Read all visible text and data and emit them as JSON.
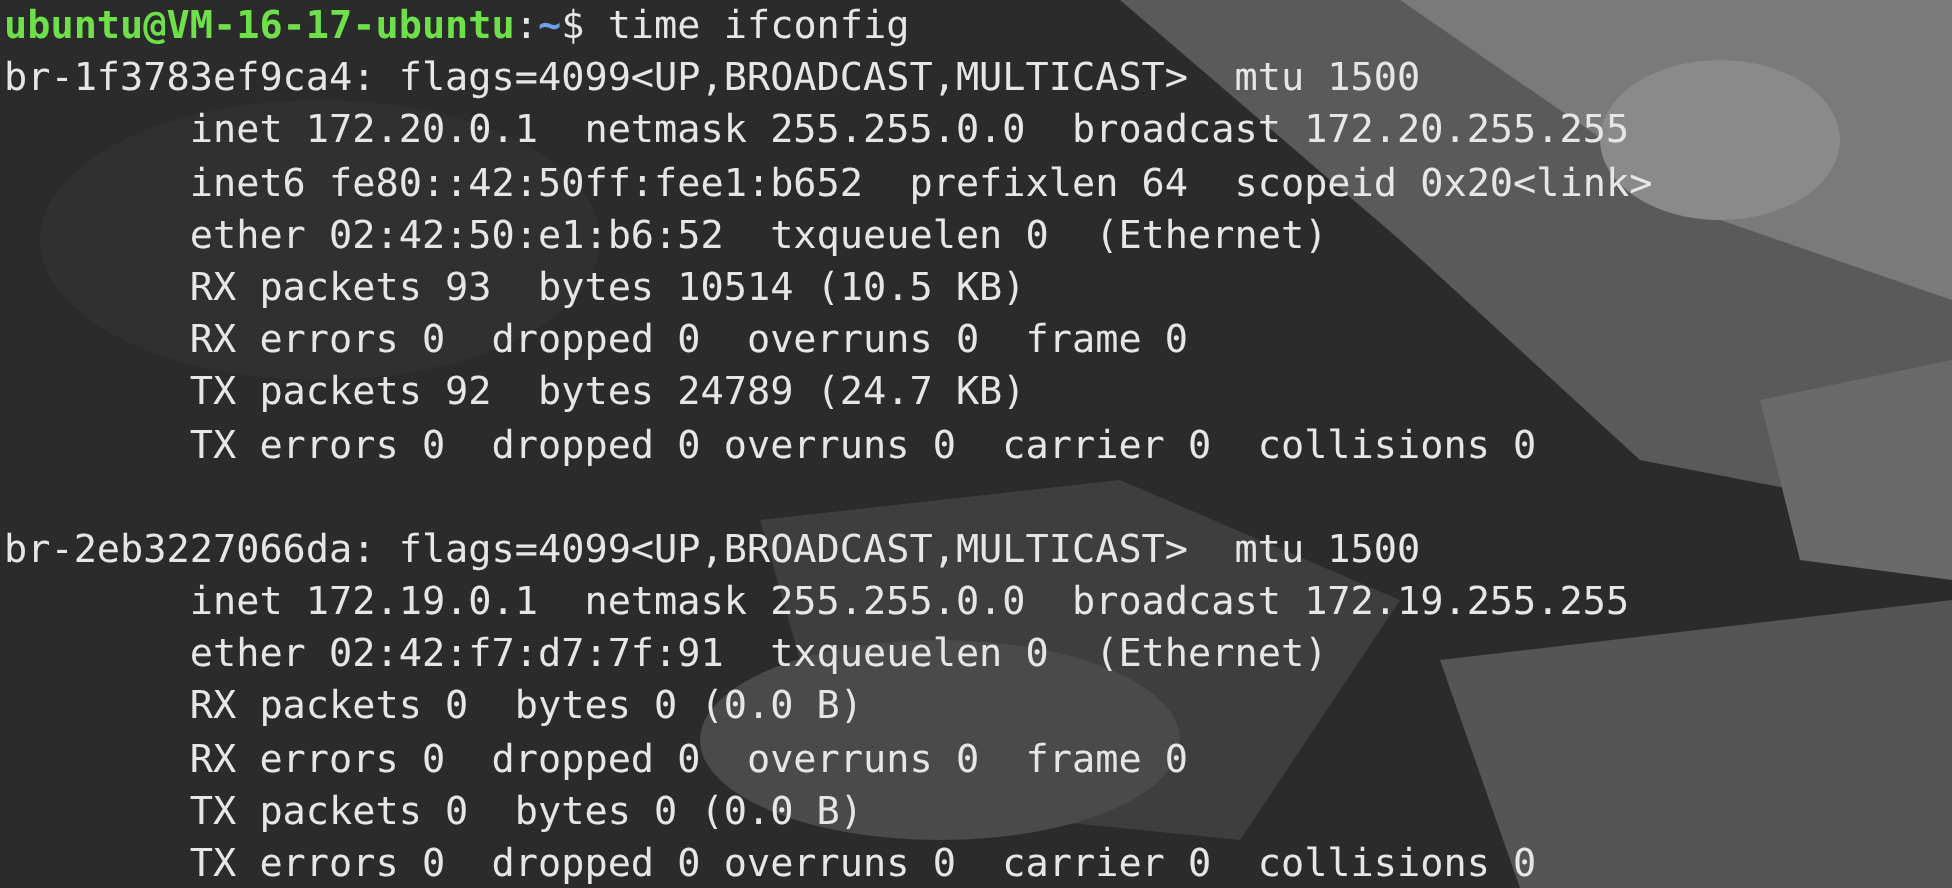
{
  "prompt": {
    "user_host": "ubuntu@VM-16-17-ubuntu",
    "separator": ":",
    "path": "~",
    "symbol": "$",
    "command": "time ifconfig"
  },
  "interfaces": [
    {
      "lines": [
        "br-1f3783ef9ca4: flags=4099<UP,BROADCAST,MULTICAST>  mtu 1500",
        "        inet 172.20.0.1  netmask 255.255.0.0  broadcast 172.20.255.255",
        "        inet6 fe80::42:50ff:fee1:b652  prefixlen 64  scopeid 0x20<link>",
        "        ether 02:42:50:e1:b6:52  txqueuelen 0  (Ethernet)",
        "        RX packets 93  bytes 10514 (10.5 KB)",
        "        RX errors 0  dropped 0  overruns 0  frame 0",
        "        TX packets 92  bytes 24789 (24.7 KB)",
        "        TX errors 0  dropped 0 overruns 0  carrier 0  collisions 0"
      ]
    },
    {
      "lines": [
        "br-2eb3227066da: flags=4099<UP,BROADCAST,MULTICAST>  mtu 1500",
        "        inet 172.19.0.1  netmask 255.255.0.0  broadcast 172.19.255.255",
        "        ether 02:42:f7:d7:7f:91  txqueuelen 0  (Ethernet)",
        "        RX packets 0  bytes 0 (0.0 B)",
        "        RX errors 0  dropped 0  overruns 0  frame 0",
        "        TX packets 0  bytes 0 (0.0 B)",
        "        TX errors 0  dropped 0 overruns 0  carrier 0  collisions 0"
      ]
    }
  ]
}
